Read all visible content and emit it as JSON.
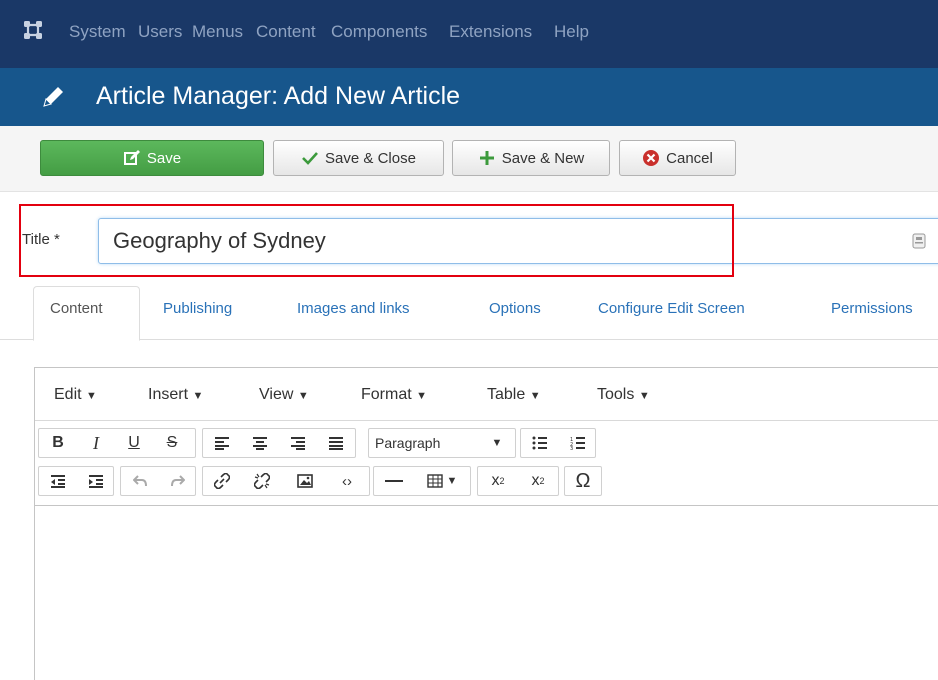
{
  "nav": {
    "items": [
      {
        "label": "System"
      },
      {
        "label": "Users"
      },
      {
        "label": "Menus"
      },
      {
        "label": "Content"
      },
      {
        "label": "Components"
      },
      {
        "label": "Extensions"
      },
      {
        "label": "Help"
      }
    ]
  },
  "header": {
    "title": "Article Manager: Add New Article"
  },
  "toolbar": {
    "save_label": "Save",
    "save_close_label": "Save & Close",
    "save_new_label": "Save & New",
    "cancel_label": "Cancel"
  },
  "form": {
    "title_label": "Title *",
    "title_value": "Geography of Sydney"
  },
  "tabs": [
    {
      "label": "Content",
      "active": true
    },
    {
      "label": "Publishing"
    },
    {
      "label": "Images and links"
    },
    {
      "label": "Options"
    },
    {
      "label": "Configure Edit Screen"
    },
    {
      "label": "Permissions"
    }
  ],
  "editor": {
    "menus": [
      {
        "label": "Edit"
      },
      {
        "label": "Insert"
      },
      {
        "label": "View"
      },
      {
        "label": "Format"
      },
      {
        "label": "Table"
      },
      {
        "label": "Tools"
      }
    ],
    "format_select": "Paragraph"
  },
  "colors": {
    "nav_bg": "#1a3867",
    "header_bg": "#17568c",
    "save_green": "#5cb85c",
    "link_blue": "#2a72b8",
    "highlight_red": "#e3000f"
  }
}
